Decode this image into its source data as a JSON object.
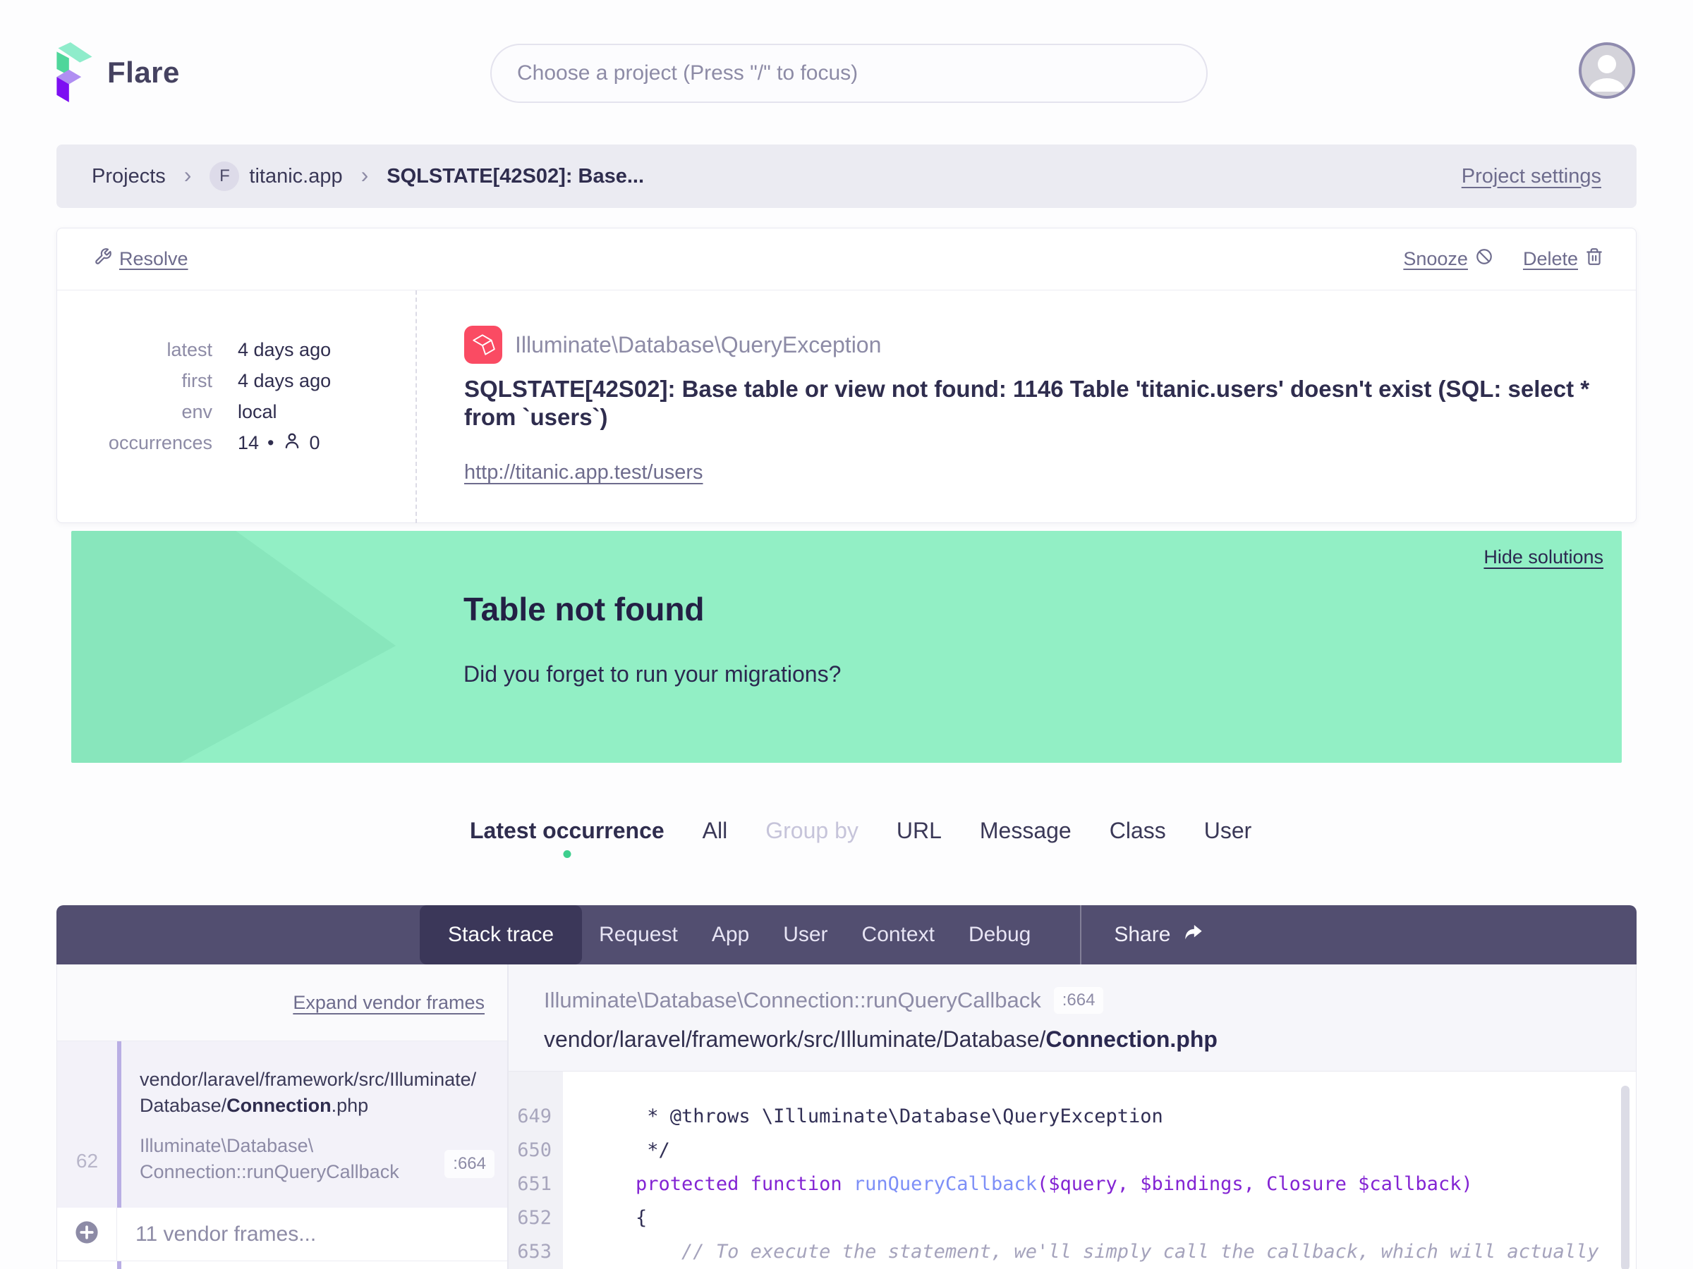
{
  "header": {
    "brand": "Flare",
    "search_placeholder": "Choose a project (Press \"/\" to focus)"
  },
  "icons": {
    "chevron": "›",
    "bullet": "•"
  },
  "breadcrumb": {
    "projects": "Projects",
    "project_badge": "F",
    "project": "titanic.app",
    "current": "SQLSTATE[42S02]: Base...",
    "settings": "Project settings"
  },
  "error_card": {
    "resolve": "Resolve",
    "snooze": "Snooze",
    "delete": "Delete",
    "stats": [
      {
        "label": "latest",
        "value": "4 days ago"
      },
      {
        "label": "first",
        "value": "4 days ago"
      },
      {
        "label": "env",
        "value": "local"
      },
      {
        "label": "occurrences",
        "value": "14",
        "users": "0"
      }
    ],
    "exception_class": "Illuminate\\Database\\QueryException",
    "message": "SQLSTATE[42S02]: Base table or view not found: 1146 Table 'titanic.users' doesn't exist (SQL: select * from `users`)",
    "url": "http://titanic.app.test/users"
  },
  "solution": {
    "hide": "Hide solutions",
    "title": "Table not found",
    "body": "Did you forget to run your migrations?"
  },
  "occurrence_tabs": {
    "items": [
      {
        "label": "Latest occurrence"
      },
      {
        "label": "All"
      },
      {
        "label": "Group by"
      },
      {
        "label": "URL"
      },
      {
        "label": "Message"
      },
      {
        "label": "Class"
      },
      {
        "label": "User"
      }
    ]
  },
  "detail_nav": {
    "items": [
      "Stack trace",
      "Request",
      "App",
      "User",
      "Context",
      "Debug"
    ],
    "share": "Share"
  },
  "stack_trace": {
    "expand": "Expand vendor frames",
    "frame": {
      "line_no": "62",
      "path_line1": "vendor/laravel/framework/src/Illuminate/",
      "path_line2_prefix": "Database/",
      "path_line2_bold": "Connection",
      "path_line2_suffix": ".php",
      "class_line1": "Illuminate\\Database\\",
      "class_line2": "Connection::runQueryCallback",
      "badge": ":664"
    },
    "vendor": "11 vendor frames...",
    "header": {
      "class": "Illuminate\\Database\\Connection::runQueryCallback",
      "badge": ":664",
      "path_prefix": "vendor/laravel/framework/src/Illuminate/Database/",
      "path_bold": "Connection.php"
    },
    "code": {
      "lines": [
        {
          "num": "649",
          "tokens": [
            {
              "text": "     * @throws \\Illuminate\\Database\\QueryException"
            }
          ]
        },
        {
          "num": "650",
          "tokens": [
            {
              "text": "     */"
            }
          ]
        },
        {
          "num": "651",
          "tokens": [
            {
              "text": "    "
            },
            {
              "text": "protected function"
            },
            {
              "text": " "
            },
            {
              "text": "runQueryCallback"
            },
            {
              "text": "($query, $bindings, Closure $callback)"
            }
          ]
        },
        {
          "num": "652",
          "tokens": [
            {
              "text": "    {"
            }
          ]
        },
        {
          "num": "653",
          "tokens": [
            {
              "text": "        "
            },
            {
              "text": "// To execute the statement, we'll simply call the callback, which will actually"
            }
          ]
        }
      ]
    }
  },
  "colors": {
    "accent_green": "#3ecf8e",
    "banner_green": "#92efc5",
    "laravel_red": "#fa4b63",
    "nav_bg": "#524e70",
    "nav_active_bg": "#3b3759",
    "frame_accent": "#b9aee4"
  }
}
